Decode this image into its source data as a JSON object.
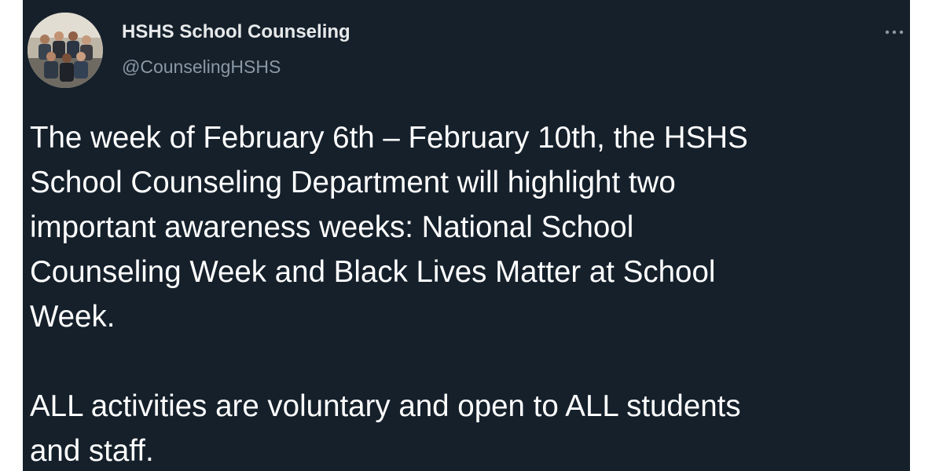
{
  "tweet": {
    "display_name": "HSHS School Counseling",
    "handle": "@CounselingHSHS",
    "avatar_icon": "group-photo-avatar",
    "more_icon": "more-options-icon",
    "paragraphs": [
      "The week of February 6th – February 10th, the HSHS\nSchool Counseling Department will highlight two\nimportant awareness weeks: National School\nCounseling Week and Black Lives Matter at School\nWeek.",
      "",
      "ALL activities are voluntary and open to ALL students\nand staff."
    ]
  },
  "colors": {
    "background": "#15202b",
    "text": "#ffffff",
    "secondary_text": "#8b98a5"
  }
}
